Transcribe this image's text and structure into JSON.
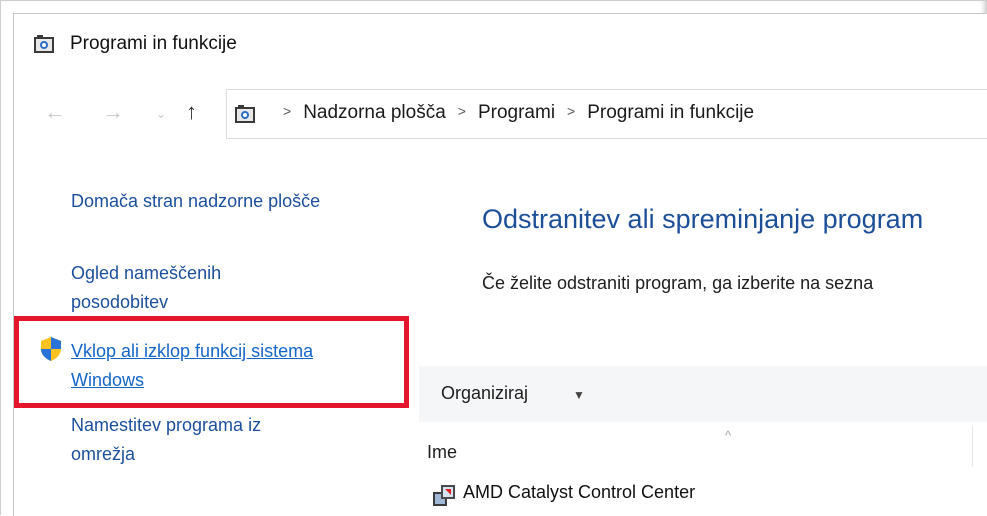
{
  "window": {
    "title": "Programi in funkcije"
  },
  "address_bar": {
    "crumbs": [
      "Nadzorna plošča",
      "Programi",
      "Programi in funkcije"
    ]
  },
  "left_pane": {
    "links": [
      {
        "label": "Domača stran nadzorne plošče"
      },
      {
        "label_line1": "Ogled nameščenih",
        "label_line2": "posodobitev"
      },
      {
        "label_line1": "Vklop ali izklop funkcij sistema",
        "label_line2": "Windows"
      },
      {
        "label_line1": "Namestitev programa iz",
        "label_line2": "omrežja"
      }
    ]
  },
  "main": {
    "heading": "Odstranitev ali spreminjanje program",
    "description": "Če želite odstraniti program, ga izberite na sezna",
    "toolbar": {
      "organize_label": "Organiziraj"
    },
    "list": {
      "column_name": "Ime",
      "rows": [
        {
          "name": "AMD Catalyst Control Center"
        }
      ]
    }
  },
  "colors": {
    "link": "#1c4f9c",
    "heading": "#1d4f99",
    "highlight": "#e3162b"
  },
  "icons": [
    "control-panel-icon",
    "back-arrow-icon",
    "forward-arrow-icon",
    "recent-dropdown-icon",
    "up-arrow-icon",
    "uac-shield-icon",
    "dropdown-arrow-icon",
    "sort-ascending-icon",
    "amd-catalyst-icon"
  ]
}
